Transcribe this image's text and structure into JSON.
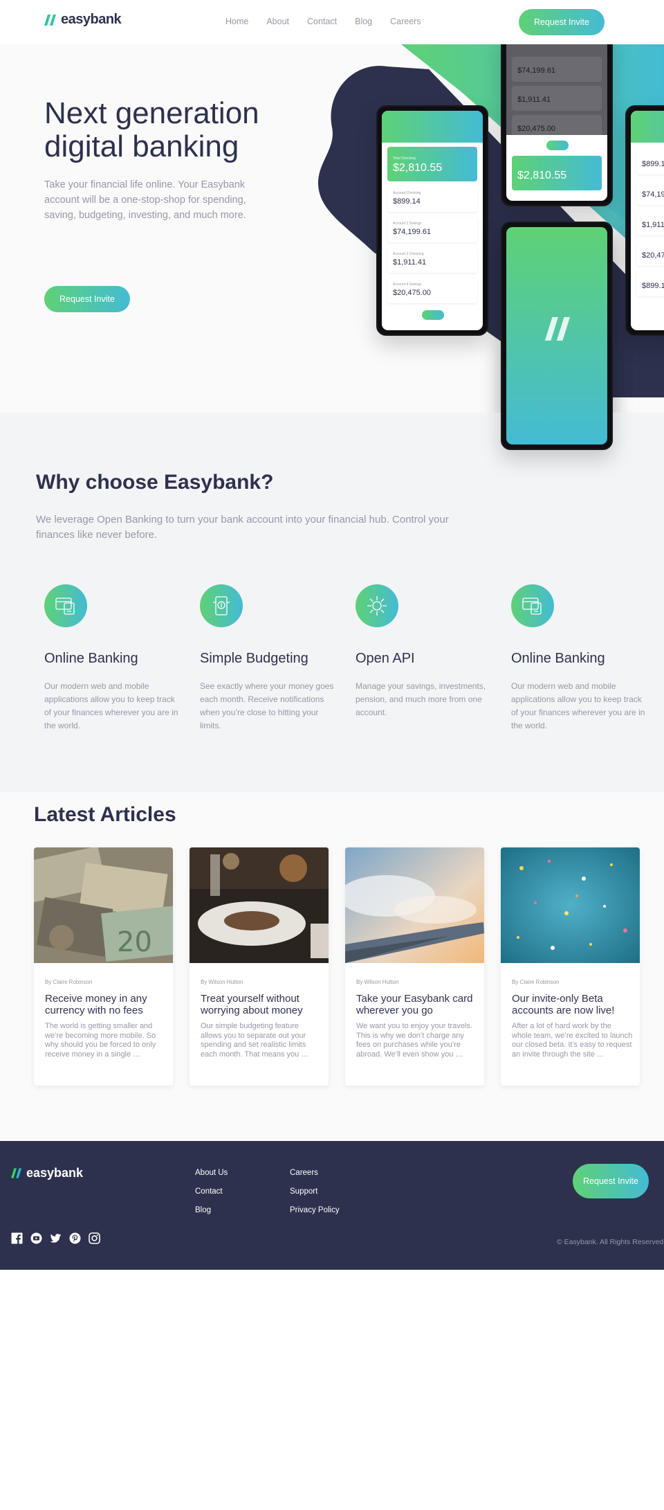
{
  "header": {
    "brand": "easybank",
    "nav": [
      "Home",
      "About",
      "Contact",
      "Blog",
      "Careers"
    ],
    "cta": "Request Invite"
  },
  "hero": {
    "title": "Next generation digital banking",
    "text": "Take your financial life online. Your Easybank account will be a one-stop-shop for spending, saving, budgeting, investing, and much more.",
    "cta": "Request Invite",
    "phone": {
      "total_label": "Total Checking",
      "total": "$2,810.55",
      "accounts": [
        {
          "label": "Account Checking",
          "value": "$899.14"
        },
        {
          "label": "Account 2 Savings",
          "value": "$74,199.61"
        },
        {
          "label": "Account 3 Checking",
          "value": "$1,911.41"
        },
        {
          "label": "Account 4 Savings",
          "value": "$20,475.00"
        }
      ]
    }
  },
  "why": {
    "title": "Why choose Easybank?",
    "subtitle": "We leverage Open Banking to turn your bank account into your financial hub. Control your finances like never before.",
    "features": [
      {
        "icon": "online-banking-icon",
        "title": "Online Banking",
        "text": "Our modern web and mobile applications allow you to keep track of your finances wherever you are in the world."
      },
      {
        "icon": "budgeting-icon",
        "title": "Simple Budgeting",
        "text": "See exactly where your money goes each month. Receive notifications when you’re close to hitting your limits."
      },
      {
        "icon": "api-icon",
        "title": "Open API",
        "text": "Manage your savings, investments, pension, and much more from one account."
      },
      {
        "icon": "online-banking-icon",
        "title": "Online Banking",
        "text": "Our modern web and mobile applications allow you to keep track of your finances wherever you are in the world."
      }
    ]
  },
  "articles": {
    "title": "Latest Articles",
    "items": [
      {
        "author": "By Claire Robinson",
        "title": "Receive money in any currency with no fees",
        "excerpt": "The world is getting smaller and we’re becoming more mobile. So why should you be forced to only receive money in a single …"
      },
      {
        "author": "By Wilson Hutton",
        "title": "Treat yourself without worrying about money",
        "excerpt": "Our simple budgeting feature allows you to separate out your spending and set realistic limits each month. That means you …"
      },
      {
        "author": "By Wilson Hutton",
        "title": "Take your Easybank card wherever you go",
        "excerpt": "We want you to enjoy your travels. This is why we don’t charge any fees on purchases while you’re abroad. We’ll even show you …"
      },
      {
        "author": "By Claire Robinson",
        "title": "Our invite-only Beta accounts are now live!",
        "excerpt": "After a lot of hard work by the whole team, we’re excited to launch our closed beta. It’s easy to request an invite through the site ..."
      }
    ]
  },
  "footer": {
    "brand": "easybank",
    "links_col1": [
      "About Us",
      "Contact",
      "Blog"
    ],
    "links_col2": [
      "Careers",
      "Support",
      "Privacy Policy"
    ],
    "cta": "Request Invite",
    "copyright": "© Easybank. All Rights Reserved",
    "social": [
      "facebook-icon",
      "youtube-icon",
      "twitter-icon",
      "pinterest-icon",
      "instagram-icon"
    ]
  },
  "colors": {
    "dark_blue": "#2d314d",
    "lime_green": "#31d35c",
    "bright_cyan": "#2bb7da",
    "grayish_blue": "#9698a6",
    "light_gray": "#f3f4f6"
  }
}
